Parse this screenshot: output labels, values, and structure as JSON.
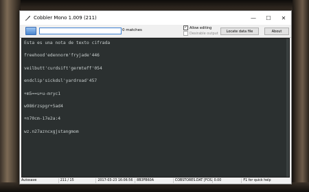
{
  "window": {
    "title": "Cobbler Mono 1.009 (211)",
    "controls": {
      "minimize": "—",
      "maximize": "☐",
      "close": "✕"
    }
  },
  "toolbar": {
    "icon": "keyboard-icon",
    "search_value": "",
    "matches_label": "0 matches",
    "allow_editing_label": "Allow editing",
    "allow_editing_checked": true,
    "desirable_output_label": "Desirable output",
    "desirable_output_checked": false,
    "locate_button": "Locate data file",
    "about_button": "About"
  },
  "editor": {
    "lines": [
      "Esta es una nota de texto cifrada",
      "",
      "freehood'edennorm'fryjade'446",
      "",
      "veilbutt'curdsift'germteff'054",
      "",
      "endclip'sickdsl'yardroad'457",
      "",
      "+m5==u+u-mryc1",
      "",
      "w986rzspgr+5ad4",
      "",
      "+n70cm-17e2a:4",
      "",
      "wz.n27azncxgjstangmom"
    ]
  },
  "statusbar": {
    "mode": "Autosave",
    "position": "211 / 15",
    "timestamp": "2017-03-23 16:06:56",
    "checksum": "8B3FB60A",
    "file": "COBSTORES.DAT [FC62]",
    "value": "0.00",
    "help": "F1 for quick help"
  },
  "colors": {
    "editor_bg": "#2b3030",
    "editor_fg": "#c9cfcf",
    "accent": "#3c7fd1"
  }
}
